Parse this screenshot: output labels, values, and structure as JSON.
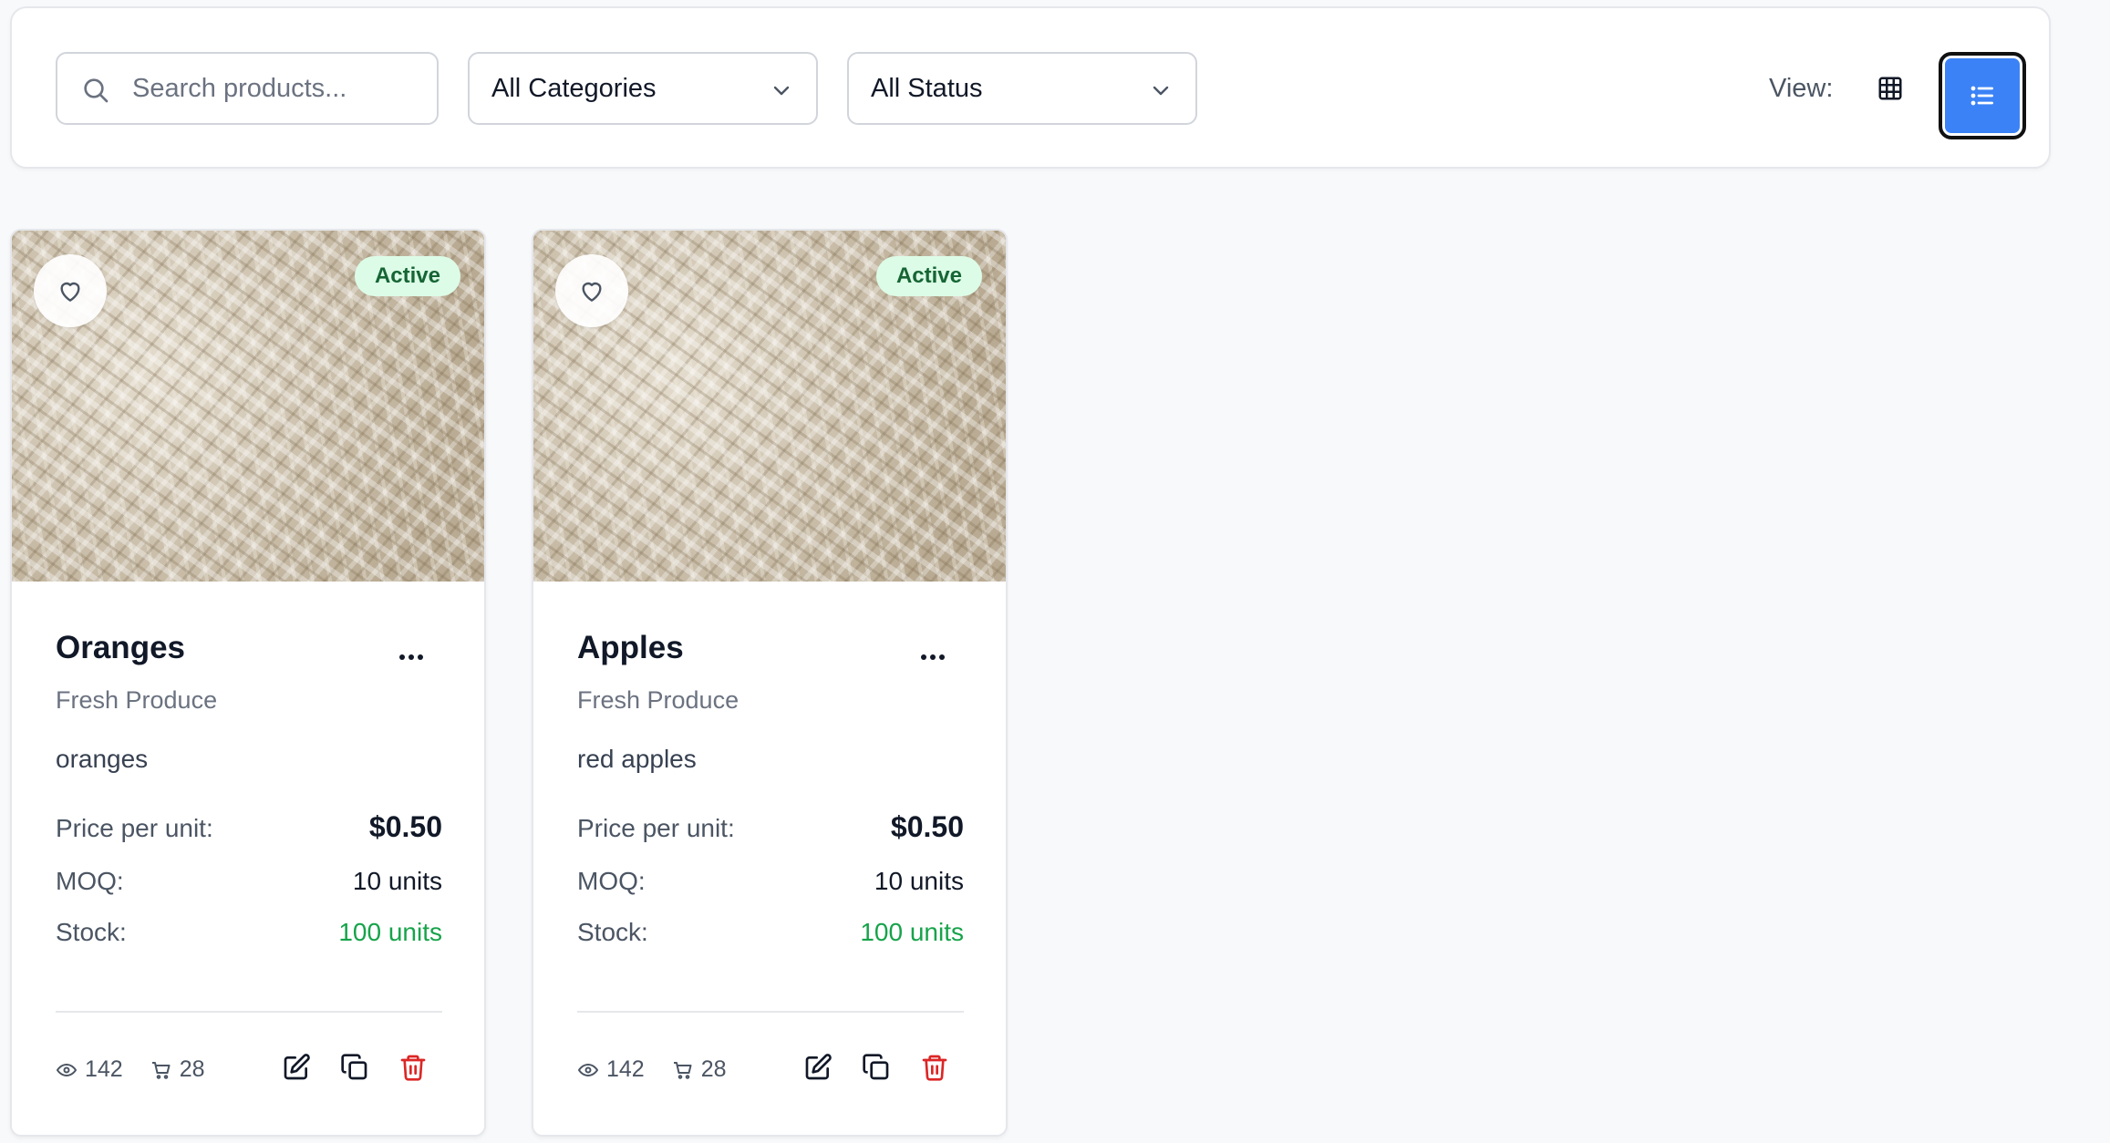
{
  "filters": {
    "search_placeholder": "Search products...",
    "category_selected": "All Categories",
    "status_selected": "All Status",
    "view_label": "View:"
  },
  "colors": {
    "accent": "#3b82f6",
    "active_badge_bg": "#dcfce7",
    "active_badge_text": "#166534",
    "stock_green": "#16a34a",
    "delete_red": "#dc2626"
  },
  "products": [
    {
      "name": "Oranges",
      "category": "Fresh Produce",
      "description": "oranges",
      "status": "Active",
      "price_label": "Price per unit:",
      "price": "$0.50",
      "moq_label": "MOQ:",
      "moq": "10 units",
      "stock_label": "Stock:",
      "stock": "100 units",
      "views": "142",
      "orders": "28"
    },
    {
      "name": "Apples",
      "category": "Fresh Produce",
      "description": "red apples",
      "status": "Active",
      "price_label": "Price per unit:",
      "price": "$0.50",
      "moq_label": "MOQ:",
      "moq": "10 units",
      "stock_label": "Stock:",
      "stock": "100 units",
      "views": "142",
      "orders": "28"
    }
  ]
}
